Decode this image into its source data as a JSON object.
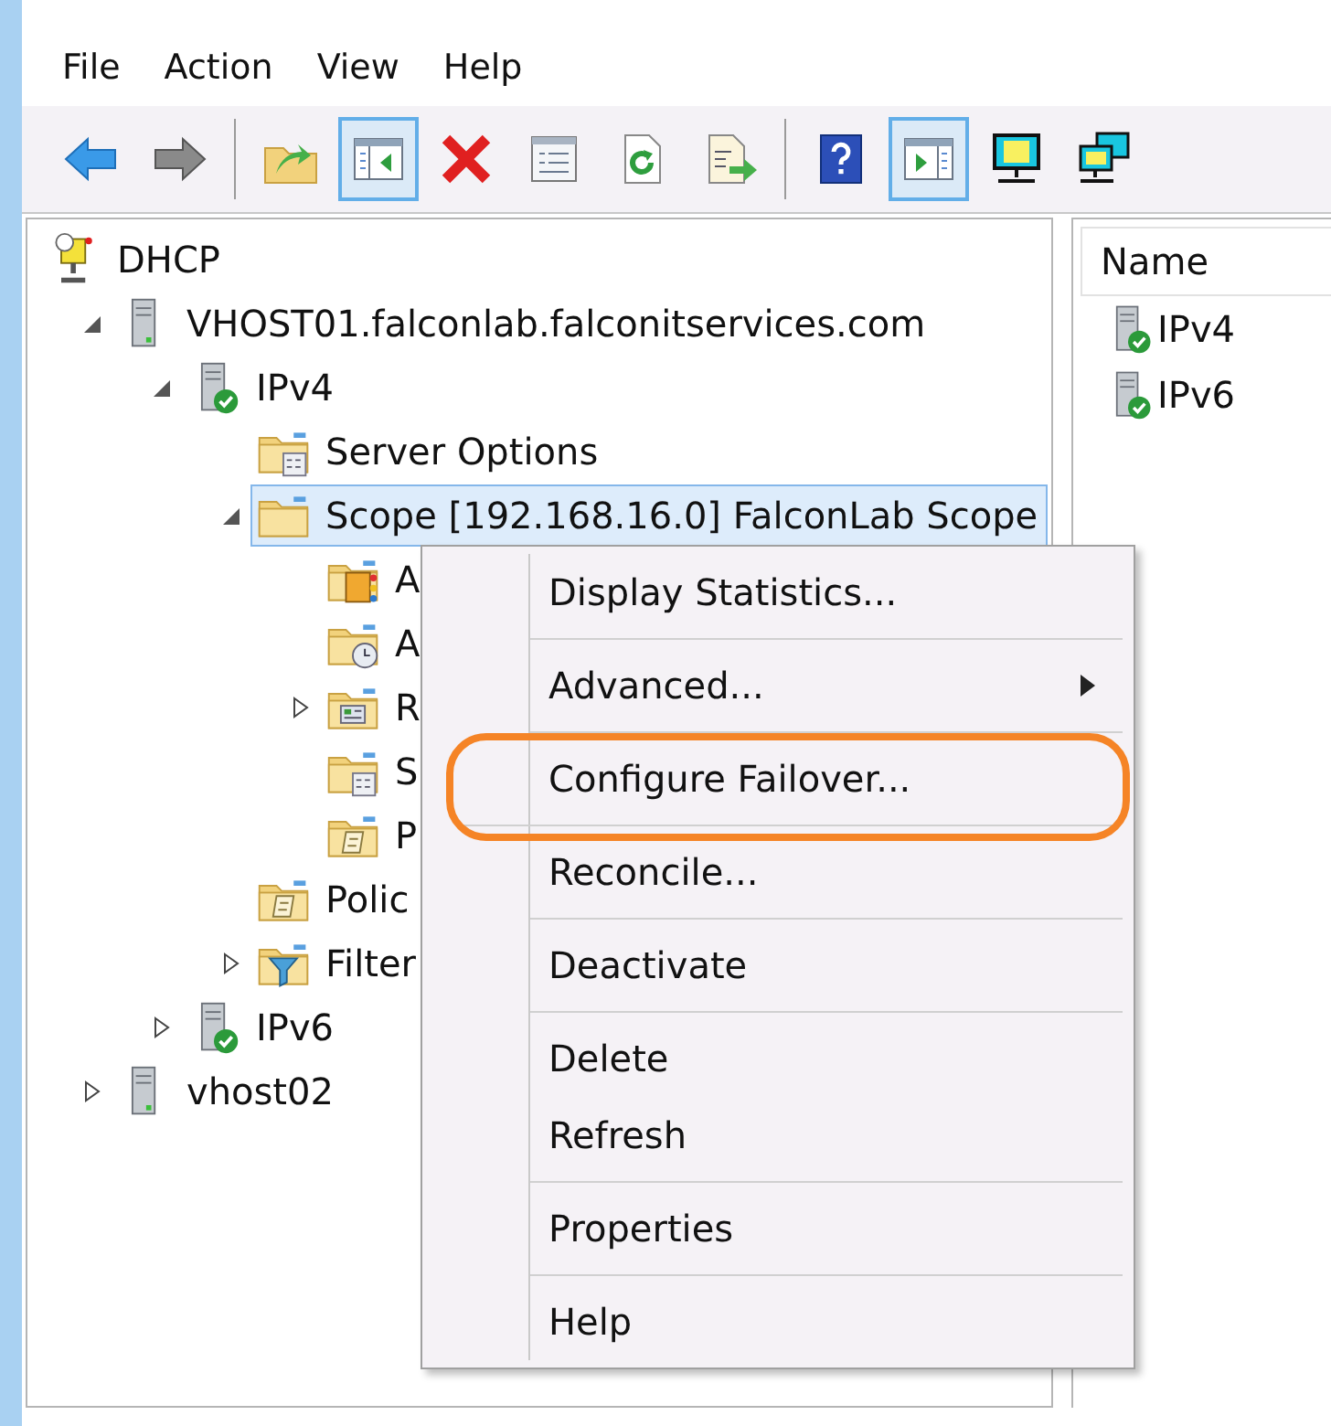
{
  "menu_bar": [
    {
      "label": "File"
    },
    {
      "label": "Action"
    },
    {
      "label": "View"
    },
    {
      "label": "Help"
    }
  ],
  "toolbar_groups": [
    [
      {
        "kind": "back",
        "pressed": false
      },
      {
        "kind": "forward",
        "pressed": false
      }
    ],
    [
      {
        "kind": "up",
        "pressed": false
      },
      {
        "kind": "console-tree",
        "pressed": true
      },
      {
        "kind": "delete",
        "pressed": false
      },
      {
        "kind": "properties",
        "pressed": false
      },
      {
        "kind": "refresh",
        "pressed": false
      },
      {
        "kind": "export",
        "pressed": false
      }
    ],
    [
      {
        "kind": "help",
        "pressed": false
      },
      {
        "kind": "action-pane",
        "pressed": true
      },
      {
        "kind": "monitor",
        "pressed": false
      },
      {
        "kind": "monitors",
        "pressed": false
      }
    ]
  ],
  "tree": [
    {
      "kind": "dhcp",
      "label": "DHCP",
      "selected": false,
      "children": [
        {
          "kind": "server",
          "label": "VHOST01.falconlab.falconitservices.com",
          "selected": false,
          "expanded": true,
          "children": [
            {
              "kind": "server-check",
              "label": "IPv4",
              "selected": false,
              "expanded": true,
              "children": [
                {
                  "kind": "folder-options",
                  "label": "Server Options",
                  "selected": false
                },
                {
                  "kind": "folder",
                  "label": "Scope [192.168.16.0] FalconLab Scope",
                  "selected": true,
                  "expanded": true,
                  "children": [
                    {
                      "kind": "folder-book",
                      "label": "A",
                      "selected": false
                    },
                    {
                      "kind": "folder-clock",
                      "label": "A",
                      "selected": false
                    },
                    {
                      "kind": "folder-grid",
                      "label": "R",
                      "selected": false,
                      "expanded": false
                    },
                    {
                      "kind": "folder-options",
                      "label": "S",
                      "selected": false
                    },
                    {
                      "kind": "folder-script",
                      "label": "P",
                      "selected": false
                    }
                  ]
                },
                {
                  "kind": "folder-script",
                  "label": "Polic",
                  "selected": false
                },
                {
                  "kind": "folder-filter",
                  "label": "Filter",
                  "selected": false,
                  "expanded": false
                }
              ]
            },
            {
              "kind": "server-check",
              "label": "IPv6",
              "selected": false,
              "expanded": false
            }
          ]
        },
        {
          "kind": "server",
          "label": "vhost02",
          "selected": false,
          "expanded": false
        }
      ]
    }
  ],
  "details": {
    "columns": [
      "Name"
    ],
    "rows": [
      {
        "kind": "server-check",
        "label": "IPv4"
      },
      {
        "kind": "server-check",
        "label": "IPv6"
      }
    ]
  },
  "context_menu": {
    "items": [
      {
        "label": "Display Statistics...",
        "submenu": false,
        "separator_after": true,
        "highlighted": false
      },
      {
        "label": "Advanced...",
        "submenu": true,
        "separator_after": true,
        "highlighted": false
      },
      {
        "label": "Configure Failover...",
        "submenu": false,
        "separator_after": true,
        "highlighted": true
      },
      {
        "label": "Reconcile...",
        "submenu": false,
        "separator_after": true,
        "highlighted": false
      },
      {
        "label": "Deactivate",
        "submenu": false,
        "separator_after": true,
        "highlighted": false
      },
      {
        "label": "Delete",
        "submenu": false,
        "separator_after": false,
        "highlighted": false
      },
      {
        "label": "Refresh",
        "submenu": false,
        "separator_after": true,
        "highlighted": false
      },
      {
        "label": "Properties",
        "submenu": false,
        "separator_after": true,
        "highlighted": false
      },
      {
        "label": "Help",
        "submenu": false,
        "separator_after": false,
        "highlighted": false
      }
    ]
  }
}
